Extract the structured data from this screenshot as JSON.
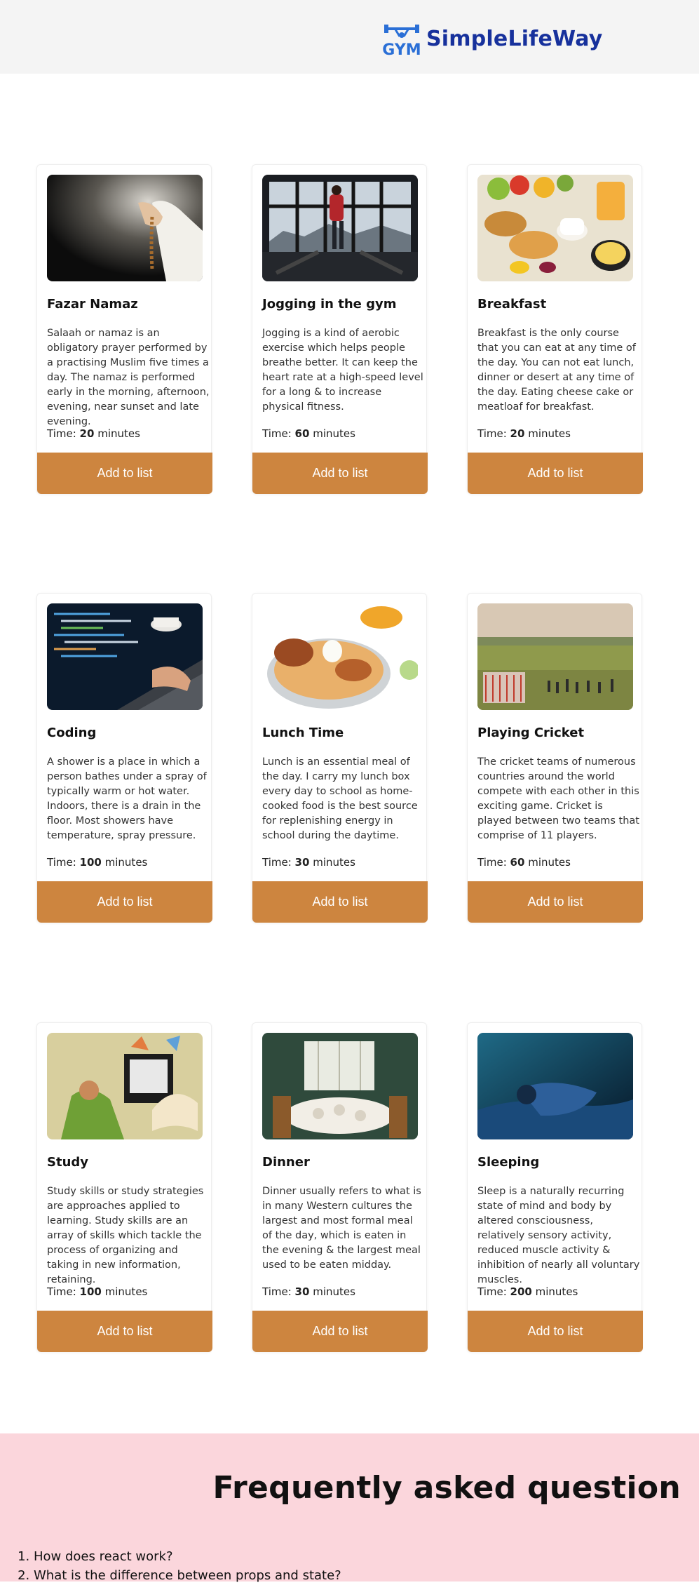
{
  "header": {
    "brand": "SimpleLifeWay",
    "logo_text": "GYM"
  },
  "cards": [
    {
      "title": "Fazar Namaz",
      "desc": "Salaah or namaz is an obligatory prayer performed by a practising Muslim five times a day. The namaz is performed early in the morning, afternoon, evening, near sunset and late evening.",
      "time_label": "Time:",
      "time": "20",
      "unit": "minutes",
      "button": "Add to list",
      "image_icon": "prayer-beads-image"
    },
    {
      "title": "Jogging in the gym",
      "desc": "Jogging is a kind of aerobic exercise which helps people breathe better. It can keep the heart rate at a high-speed level for a long & to increase physical fitness.",
      "time_label": "Time:",
      "time": "60",
      "unit": "minutes",
      "button": "Add to list",
      "image_icon": "treadmill-image"
    },
    {
      "title": "Breakfast",
      "desc": "Breakfast is the only course that you can eat at any time of the day. You can not eat lunch, dinner or desert at any time of the day. Eating cheese cake or meatloaf for breakfast.",
      "time_label": "Time:",
      "time": "20",
      "unit": "minutes",
      "button": "Add to list",
      "image_icon": "breakfast-image"
    },
    {
      "title": "Coding",
      "desc": "A shower is a place in which a person bathes under a spray of typically warm or hot water. Indoors, there is a drain in the floor. Most showers have temperature, spray pressure.",
      "time_label": "Time:",
      "time": "100",
      "unit": "minutes",
      "button": "Add to list",
      "image_icon": "laptop-code-image"
    },
    {
      "title": "Lunch Time",
      "desc": "Lunch is an essential meal of the day. I carry my lunch box every day to school as home-cooked food is the best source for replenishing energy in school during the daytime.",
      "time_label": "Time:",
      "time": "30",
      "unit": "minutes",
      "button": "Add to list",
      "image_icon": "biryani-image"
    },
    {
      "title": "Playing Cricket",
      "desc": "The cricket teams of numerous countries around the world compete with each other in this exciting game. Cricket is played between two teams that comprise of 11 players.",
      "time_label": "Time:",
      "time": "60",
      "unit": "minutes",
      "button": "Add to list",
      "image_icon": "cricket-field-image"
    },
    {
      "title": "Study",
      "desc": "Study skills or study strategies are approaches applied to learning. Study skills are an array of skills which tackle the process of organizing and taking in new information, retaining.",
      "time_label": "Time:",
      "time": "100",
      "unit": "minutes",
      "button": "Add to list",
      "image_icon": "study-desk-image"
    },
    {
      "title": "Dinner",
      "desc": "Dinner usually refers to what is in many Western cultures the largest and most formal meal of the day, which is eaten in the evening & the largest meal used to be eaten midday.",
      "time_label": "Time:",
      "time": "30",
      "unit": "minutes",
      "button": "Add to list",
      "image_icon": "dining-table-image"
    },
    {
      "title": "Sleeping",
      "desc": "Sleep is a naturally recurring state of mind and body by altered consciousness, relatively sensory activity, reduced muscle activity & inhibition of nearly all voluntary muscles.",
      "time_label": "Time:",
      "time": "200",
      "unit": "minutes",
      "button": "Add to list",
      "image_icon": "sleeping-person-image"
    }
  ],
  "faq": {
    "title": "Frequently asked question",
    "items": [
      "How does react work?",
      "What is the difference between props and state?"
    ]
  },
  "colors": {
    "button": "#cd853f",
    "brand": "#17319c",
    "faq_bg": "#fbd6dc",
    "header_bg": "#f4f4f4"
  }
}
